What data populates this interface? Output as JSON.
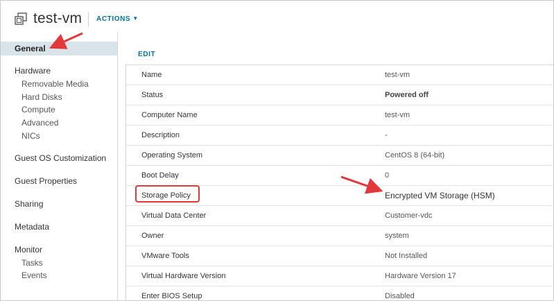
{
  "header": {
    "title": "test-vm",
    "actions_label": "ACTIONS",
    "vm_icon": "virtual-machine-icon",
    "chevron_icon": "chevron-down-icon"
  },
  "sidebar": {
    "items": [
      {
        "label": "General",
        "active": true,
        "level": 0
      },
      {
        "label": "Hardware",
        "level": 0
      },
      {
        "label": "Removable Media",
        "level": 1
      },
      {
        "label": "Hard Disks",
        "level": 1
      },
      {
        "label": "Compute",
        "level": 1
      },
      {
        "label": "Advanced",
        "level": 1
      },
      {
        "label": "NICs",
        "level": 1
      },
      {
        "label": "Guest OS Customization",
        "level": 0
      },
      {
        "label": "Guest Properties",
        "level": 0
      },
      {
        "label": "Sharing",
        "level": 0
      },
      {
        "label": "Metadata",
        "level": 0
      },
      {
        "label": "Monitor",
        "level": 0
      },
      {
        "label": "Tasks",
        "level": 1
      },
      {
        "label": "Events",
        "level": 1
      }
    ]
  },
  "main": {
    "edit_label": "EDIT",
    "properties": [
      {
        "name": "Name",
        "value": "test-vm"
      },
      {
        "name": "Status",
        "value": "Powered off"
      },
      {
        "name": "Computer Name",
        "value": "test-vm"
      },
      {
        "name": "Description",
        "value": "-"
      },
      {
        "name": "Operating System",
        "value": "CentOS 8 (64-bit)"
      },
      {
        "name": "Boot Delay",
        "value": "0"
      },
      {
        "name": "Storage Policy",
        "value": "Encrypted VM Storage (HSM)"
      },
      {
        "name": "Virtual Data Center",
        "value": "Customer-vdc"
      },
      {
        "name": "Owner",
        "value": "system"
      },
      {
        "name": "VMware Tools",
        "value": "Not Installed"
      },
      {
        "name": "Virtual Hardware Version",
        "value": "Hardware Version 17"
      },
      {
        "name": "Enter BIOS Setup",
        "value": "Disabled"
      }
    ]
  },
  "colors": {
    "accent": "#0072a3",
    "active_bg": "#d9e4ea",
    "annotation_red": "#e2383a"
  }
}
